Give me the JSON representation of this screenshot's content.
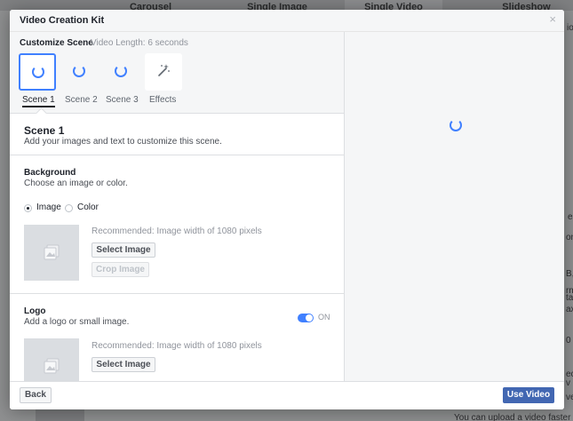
{
  "background": {
    "tabs": [
      "Carousel",
      "Single Image",
      "Single Video",
      "Slideshow"
    ],
    "side_fragments": [
      "io",
      "ea",
      "ons",
      "B, ,",
      "rm",
      "ta",
      "ax",
      "0",
      "ec",
      "v",
      "ve"
    ],
    "bottom_fragment": "You can upload a video faster by"
  },
  "modal": {
    "title": "Video Creation Kit",
    "close_glyph": "×"
  },
  "customize": {
    "title": "Customize Scene",
    "video_length": "Video Length: 6 seconds",
    "scenes": [
      {
        "label": "Scene 1",
        "selected": true
      },
      {
        "label": "Scene 2",
        "selected": false
      },
      {
        "label": "Scene 3",
        "selected": false
      },
      {
        "label": "Effects",
        "selected": false,
        "icon": "magic-wand-icon"
      }
    ]
  },
  "scene_header": {
    "title": "Scene 1",
    "description": "Add your images and text to customize this scene."
  },
  "background_section": {
    "title": "Background",
    "description": "Choose an image or color.",
    "options": [
      {
        "label": "Image",
        "checked": true
      },
      {
        "label": "Color",
        "checked": false
      }
    ],
    "recommendation": "Recommended: Image width of 1080 pixels",
    "select_label": "Select Image",
    "crop_label": "Crop Image"
  },
  "logo_section": {
    "title": "Logo",
    "description": "Add a logo or small image.",
    "toggle_label": "ON",
    "toggle_on": true,
    "recommendation": "Recommended: Image width of 1080 pixels",
    "select_label": "Select Image"
  },
  "footer": {
    "back_label": "Back",
    "use_label": "Use Video"
  },
  "colors": {
    "accent": "#4080ff",
    "primary_button": "#4267b2"
  }
}
